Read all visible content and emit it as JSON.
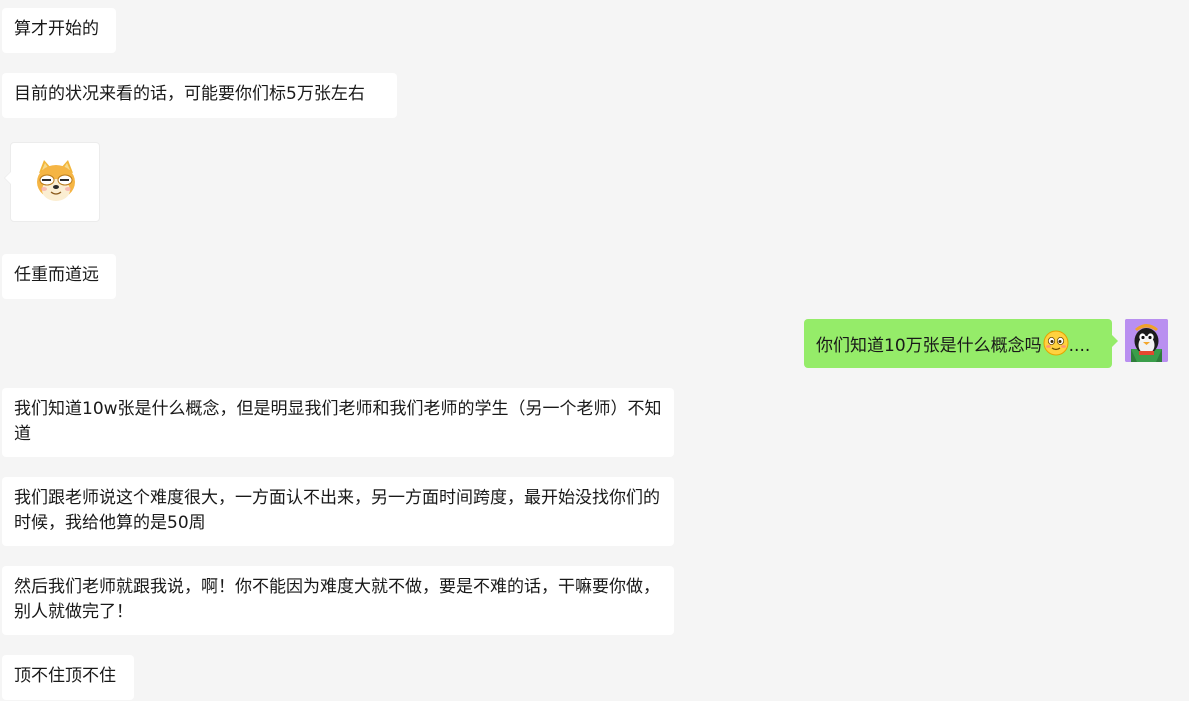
{
  "messages": [
    {
      "side": "left",
      "text": "算才开始的"
    },
    {
      "side": "left",
      "text": "目前的状况来看的话，可能要你们标5万张左右"
    },
    {
      "side": "left",
      "sticker": "shiba-dog-sticker"
    },
    {
      "side": "left",
      "text": "任重而道远"
    },
    {
      "side": "right",
      "text": "你们知道10万张是什么概念吗",
      "emoji": "smiling-face-emoji",
      "suffix": "...."
    },
    {
      "side": "left",
      "text": "我们知道10w张是什么概念，但是明显我们老师和我们老师的学生（另一个老师）不知道"
    },
    {
      "side": "left",
      "text": "我们跟老师说这个难度很大，一方面认不出来，另一方面时间跨度，最开始没找你们的时候，我给他算的是50周"
    },
    {
      "side": "left",
      "text": "然后我们老师就跟我说，啊！你不能因为难度大就不做，要是不难的话，干嘛要你做，别人就做完了！"
    },
    {
      "side": "left",
      "text": "顶不住顶不住"
    }
  ],
  "colors": {
    "background": "#f5f5f5",
    "incoming_bubble": "#ffffff",
    "outgoing_bubble": "#95ec69",
    "avatar_bg": "#b98ff0"
  },
  "icons": {
    "avatar": "penguin-avatar-icon"
  }
}
